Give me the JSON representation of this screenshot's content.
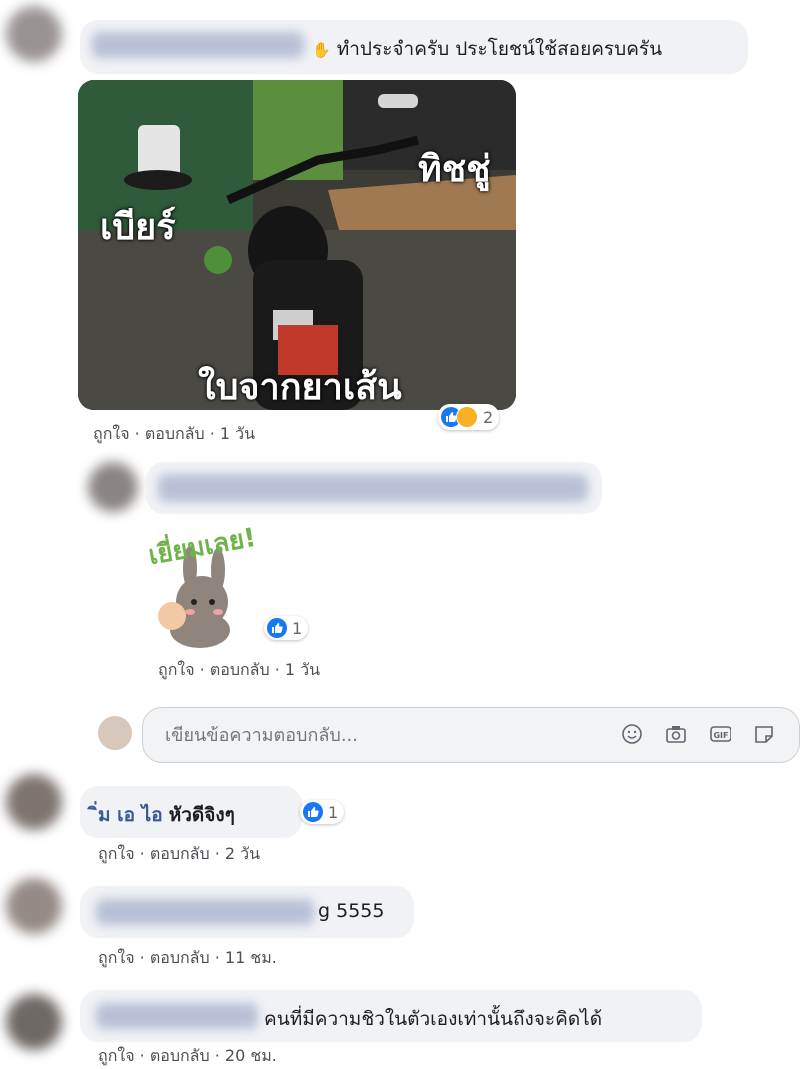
{
  "comments": [
    {
      "text": "ทำประจำครับ ประโยชน์ใช้สอยครบครัน",
      "image_captions": {
        "beer": "เบียร์",
        "tissue": "ทิชชู่",
        "leaf": "ใบจากยาเส้น"
      },
      "reactions": "2",
      "actions": {
        "like": "ถูกใจ",
        "reply": "ตอบกลับ",
        "time": "1 วัน"
      }
    },
    {
      "sticker_text": "เยี่ยมเลย!",
      "reactions": "1",
      "actions": {
        "like": "ถูกใจ",
        "reply": "ตอบกลับ",
        "time": "1 วัน"
      }
    },
    {
      "author_tail": "ิ่ม เอ ไอ",
      "text": "หัวดีจิงๆ",
      "reactions": "1",
      "actions": {
        "like": "ถูกใจ",
        "reply": "ตอบกลับ",
        "time": "2 วัน"
      }
    },
    {
      "text": "g 5555",
      "actions": {
        "like": "ถูกใจ",
        "reply": "ตอบกลับ",
        "time": "11 ชม."
      }
    },
    {
      "text": "คนที่มีความชิวในตัวเองเท่านั้นถึงจะคิดได้",
      "actions": {
        "like": "ถูกใจ",
        "reply": "ตอบกลับ",
        "time": "20 ชม."
      }
    }
  ],
  "reply_box": {
    "placeholder": "เขียนข้อความตอบกลับ...",
    "icons": [
      "emoji-icon",
      "camera-icon",
      "gif-icon",
      "sticker-icon"
    ]
  },
  "colors": {
    "link": "#385898",
    "like_blue": "#1877f2",
    "bubble": "#f0f2f5"
  }
}
